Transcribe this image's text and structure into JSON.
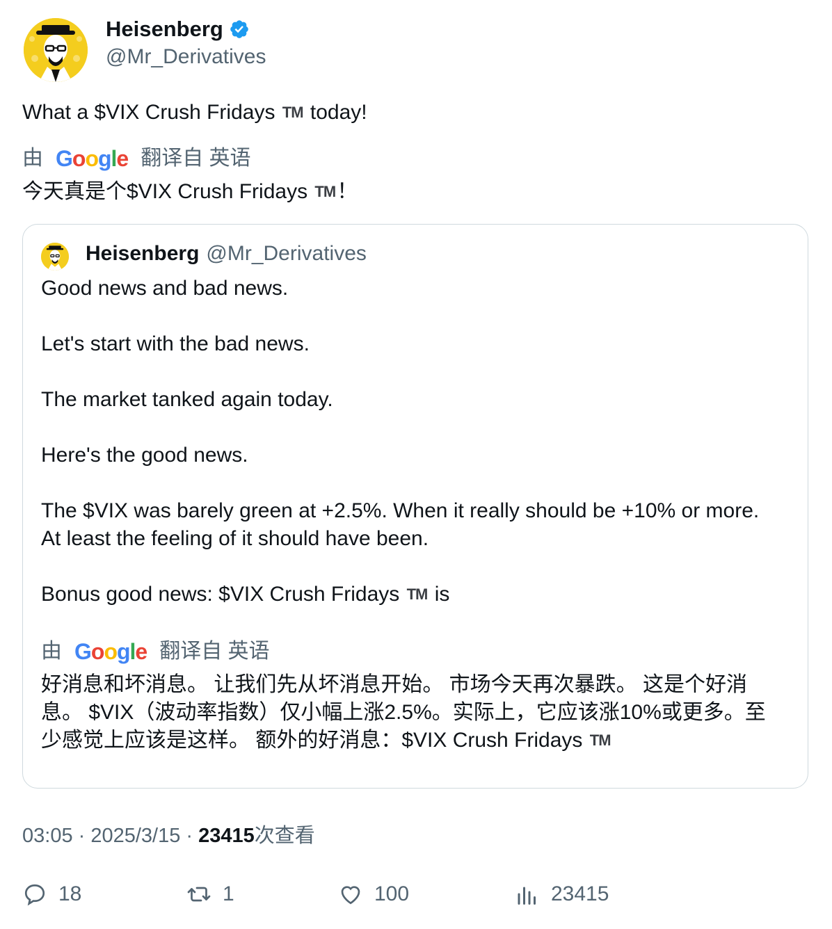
{
  "tweet": {
    "author": {
      "name": "Heisenberg",
      "handle": "@Mr_Derivatives",
      "verified": true
    },
    "text_before": "What a $VIX Crush Fridays ",
    "tm": "TM",
    "text_after": " today!",
    "translation": {
      "prefix": "由",
      "provider": "Google",
      "suffix": "翻译自 英语",
      "text_before": "今天真是个$VIX Crush Fridays ",
      "text_after": "！"
    },
    "timestamp": "03:05 · 2025/3/15 · ",
    "views_count": "23415",
    "views_label": "次查看"
  },
  "quote": {
    "author": {
      "name": "Heisenberg",
      "handle": "@Mr_Derivatives"
    },
    "paragraphs": [
      "Good news and bad news.",
      "Let's start with the bad news.",
      "The market tanked again today.",
      "Here's the good news.",
      "The $VIX was barely green at +2.5%. When it really should be +10% or more. At least the feeling of it should have been."
    ],
    "last_paragraph_before": "Bonus good news: $VIX Crush Fridays ",
    "last_paragraph_after": " is",
    "translation": {
      "prefix": "由",
      "provider": "Google",
      "suffix": "翻译自 英语",
      "text": "好消息和坏消息。 让我们先从坏消息开始。 市场今天再次暴跌。 这是个好消息。 $VIX（波动率指数）仅小幅上涨2.5%。实际上，它应该涨10%或更多。至少感觉上应该是这样。 额外的好消息：$VIX Crush Fridays "
    }
  },
  "actions": {
    "replies": "18",
    "retweets": "1",
    "likes": "100",
    "views": "23415"
  },
  "colors": {
    "verified": "#1d9bf0",
    "secondary_text": "#536471",
    "avatar_bg": "#f4cd1e"
  }
}
